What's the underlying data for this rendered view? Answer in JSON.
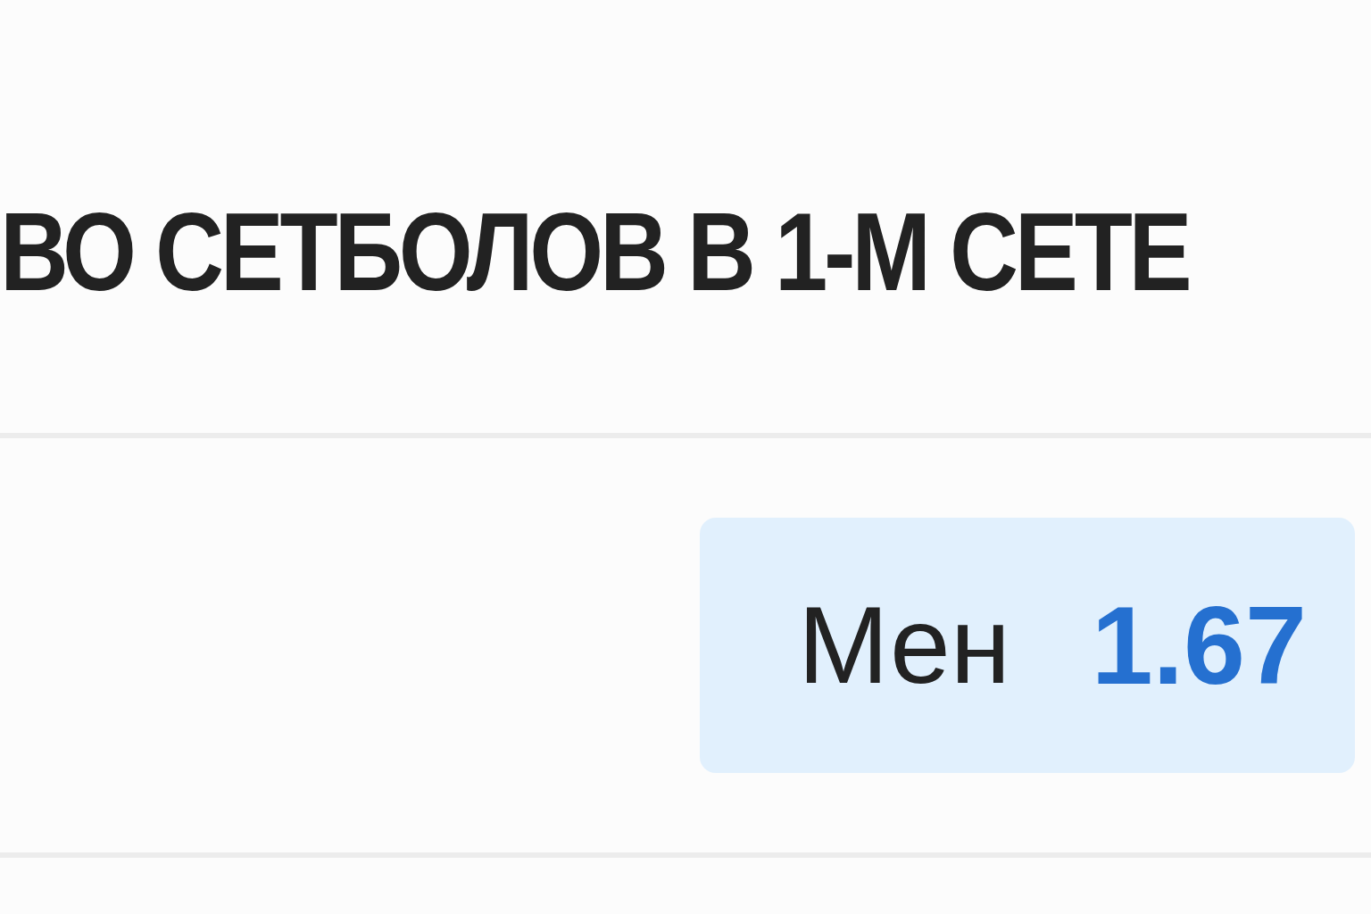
{
  "market": {
    "title": "ВО СЕТБОЛОВ В 1-М СЕТЕ"
  },
  "outcomes": [
    {
      "label": "Мен",
      "odds": "1.67"
    }
  ]
}
